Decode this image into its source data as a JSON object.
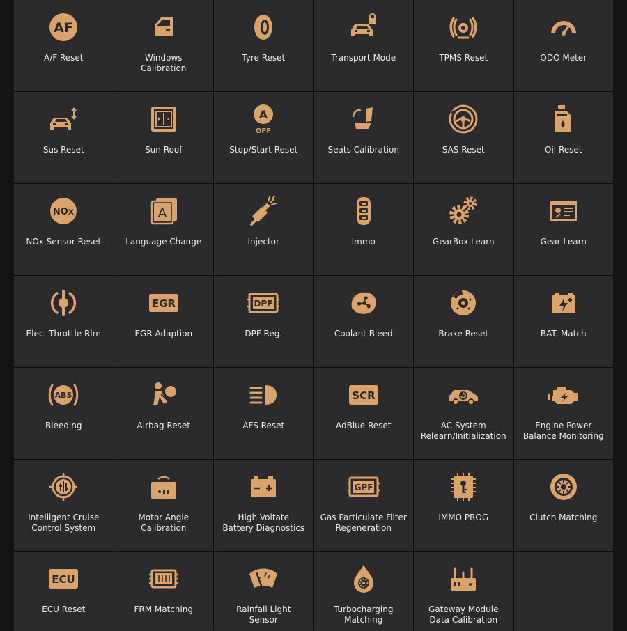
{
  "theme": {
    "accent": "#d9a36b",
    "tile_background": "#2b2b2d",
    "grid_line": "#0b0b0b",
    "label_color": "#ececec"
  },
  "items": [
    {
      "label": "A/F Reset",
      "icon": "af-badge-icon",
      "icon_text": "AF"
    },
    {
      "label": "Windows\nCalibration",
      "icon": "car-door-window-icon"
    },
    {
      "label": "Tyre Reset",
      "icon": "tyre-icon"
    },
    {
      "label": "Transport Mode",
      "icon": "car-lock-icon"
    },
    {
      "label": "TPMS Reset",
      "icon": "tpms-icon"
    },
    {
      "label": "ODO Meter",
      "icon": "speedometer-icon"
    },
    {
      "label": "Sus Reset",
      "icon": "car-suspension-icon"
    },
    {
      "label": "Sun Roof",
      "icon": "sunroof-icon"
    },
    {
      "label": "Stop/Start Reset",
      "icon": "auto-stop-start-icon",
      "icon_text": "A",
      "icon_subtext": "OFF"
    },
    {
      "label": "Seats Calibration",
      "icon": "seat-icon"
    },
    {
      "label": "SAS Reset",
      "icon": "steering-wheel-icon"
    },
    {
      "label": "Oil Reset",
      "icon": "oil-can-icon"
    },
    {
      "label": "NOx Sensor Reset",
      "icon": "nox-badge-icon",
      "icon_text": "NOx"
    },
    {
      "label": "Language Change",
      "icon": "language-icon",
      "icon_text": "A"
    },
    {
      "label": "Injector",
      "icon": "injector-icon"
    },
    {
      "label": "Immo",
      "icon": "car-key-icon"
    },
    {
      "label": "GearBox Learn",
      "icon": "gears-icon"
    },
    {
      "label": "Gear Learn",
      "icon": "gear-learn-icon"
    },
    {
      "label": "Elec. Throttle Rlrn",
      "icon": "throttle-icon"
    },
    {
      "label": "EGR Adaption",
      "icon": "egr-badge-icon",
      "icon_text": "EGR"
    },
    {
      "label": "DPF Reg.",
      "icon": "dpf-badge-icon",
      "icon_text": "DPF"
    },
    {
      "label": "Coolant Bleed",
      "icon": "coolant-fan-icon"
    },
    {
      "label": "Brake Reset",
      "icon": "brake-disc-icon"
    },
    {
      "label": "BAT. Match",
      "icon": "battery-icon"
    },
    {
      "label": "Bleeding",
      "icon": "abs-icon",
      "icon_text": "ABS"
    },
    {
      "label": "Airbag Reset",
      "icon": "airbag-icon"
    },
    {
      "label": "AFS Reset",
      "icon": "headlight-icon"
    },
    {
      "label": "AdBlue Reset",
      "icon": "scr-badge-icon",
      "icon_text": "SCR"
    },
    {
      "label": "AC System\nRelearn/Initialization",
      "icon": "car-ac-icon"
    },
    {
      "label": "Engine Power\nBalance Monitoring",
      "icon": "engine-icon"
    },
    {
      "label": "Intelligent Cruise\nControl System",
      "icon": "cruise-control-icon"
    },
    {
      "label": "Motor Angle\nCalibration",
      "icon": "motor-angle-icon"
    },
    {
      "label": "High Voltate\nBattery Diagnostics",
      "icon": "hv-battery-icon"
    },
    {
      "label": "Gas Particulate Filter\nRegeneration",
      "icon": "gpf-badge-icon",
      "icon_text": "GPF"
    },
    {
      "label": "IMMO PROG",
      "icon": "immo-chip-icon"
    },
    {
      "label": "Clutch Matching",
      "icon": "clutch-icon"
    },
    {
      "label": "ECU Reset",
      "icon": "ecu-badge-icon",
      "icon_text": "ECU"
    },
    {
      "label": "FRM Matching",
      "icon": "frm-module-icon"
    },
    {
      "label": "Rainfall Light\nSensor",
      "icon": "wiper-icon"
    },
    {
      "label": "Turbocharging\nMatching",
      "icon": "turbo-icon"
    },
    {
      "label": "Gateway Module\nData Calibration",
      "icon": "gateway-icon"
    }
  ]
}
